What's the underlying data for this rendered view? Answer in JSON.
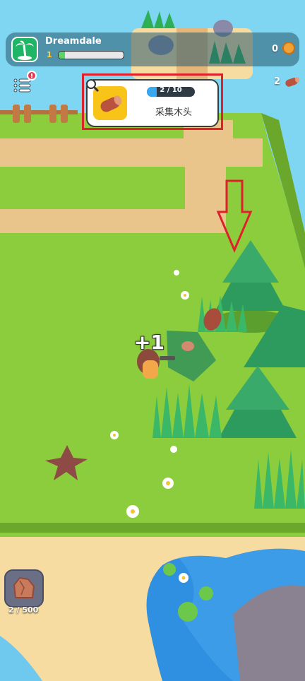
{
  "island": {
    "name": "Dreamdale",
    "level": "1",
    "xp_progress": 0.1
  },
  "currency": {
    "coins": "0",
    "wood": "2"
  },
  "menu": {
    "alert": "!"
  },
  "quest": {
    "progress_text": "2 / 10",
    "progress": 0.2,
    "title": "采集木头"
  },
  "popup": {
    "gain_text": "+1"
  },
  "inventory": {
    "count": "2 / 500"
  },
  "colors": {
    "grass": "#8ccd3e",
    "sand": "#f6dca0",
    "path": "#e9c48b",
    "water": "#2f8fe0",
    "highlight": "#e0202a"
  }
}
